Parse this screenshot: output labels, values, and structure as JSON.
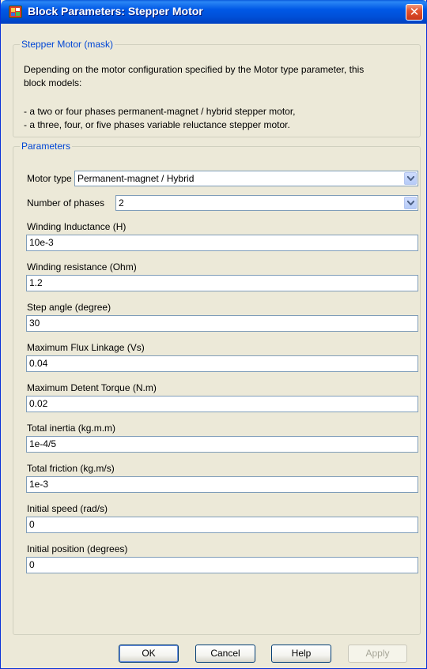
{
  "window": {
    "title": "Block Parameters: Stepper Motor",
    "close_glyph": "✕"
  },
  "mask": {
    "legend": "Stepper Motor (mask)",
    "description_line1": "Depending on the motor configuration specified by the Motor type  parameter,  this",
    "description_line2": "block models:",
    "bullet1": "- a two or four phases permanent-magnet / hybrid stepper motor,",
    "bullet2": "- a three, four, or five phases variable reluctance stepper motor."
  },
  "params": {
    "legend": "Parameters",
    "motor_type_label": "Motor type",
    "motor_type_value": "Permanent-magnet / Hybrid",
    "phases_label": "Number of phases",
    "phases_value": "2",
    "fields": [
      {
        "label": "Winding Inductance (H)",
        "value": "10e-3"
      },
      {
        "label": "Winding resistance (Ohm)",
        "value": "1.2"
      },
      {
        "label": "Step angle (degree)",
        "value": "30"
      },
      {
        "label": "Maximum Flux Linkage (Vs)",
        "value": "0.04"
      },
      {
        "label": "Maximum Detent Torque (N.m)",
        "value": "0.02"
      },
      {
        "label": "Total inertia (kg.m.m)",
        "value": "1e-4/5"
      },
      {
        "label": "Total friction (kg.m/s)",
        "value": "1e-3"
      },
      {
        "label": "Initial speed (rad/s)",
        "value": "0"
      },
      {
        "label": "Initial position (degrees)",
        "value": "0"
      }
    ]
  },
  "buttons": {
    "ok": "OK",
    "cancel": "Cancel",
    "help": "Help",
    "apply": "Apply"
  },
  "colors": {
    "title_bar": "#0058e6",
    "legend_text": "#0046d5",
    "window_bg": "#ece9d8",
    "close_button": "#e2532e"
  }
}
